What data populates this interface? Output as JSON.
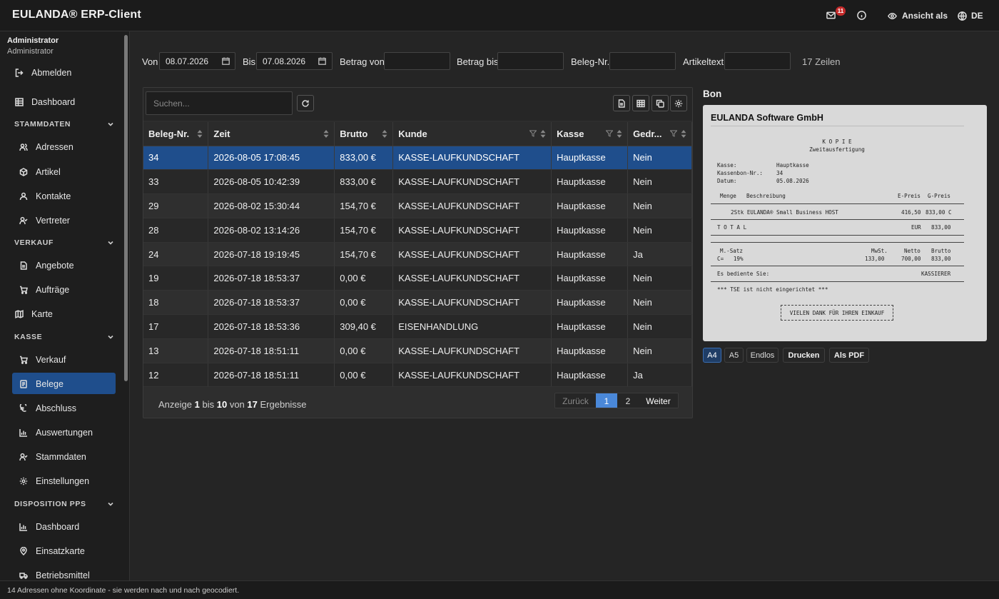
{
  "app": {
    "title": "EULANDA® ERP-Client"
  },
  "topbar": {
    "mail_badge": "11",
    "view_as": "Ansicht als",
    "lang": "DE"
  },
  "user": {
    "name": "Administrator",
    "role": "Administrator"
  },
  "sidebar": {
    "logout": "Abmelden",
    "dashboard": "Dashboard",
    "sections": {
      "stammdaten": {
        "title": "STAMMDATEN",
        "items": [
          "Adressen",
          "Artikel",
          "Kontakte",
          "Vertreter"
        ]
      },
      "verkauf": {
        "title": "VERKAUF",
        "items": [
          "Angebote",
          "Aufträge",
          "Karte"
        ]
      },
      "kasse": {
        "title": "KASSE",
        "items": [
          "Verkauf",
          "Belege",
          "Abschluss",
          "Auswertungen",
          "Stammdaten",
          "Einstellungen"
        ]
      },
      "dispo": {
        "title": "DISPOSITION PPS",
        "items": [
          "Dashboard",
          "Einsatzkarte",
          "Betriebsmittel"
        ]
      }
    }
  },
  "filters": {
    "von_label": "Von",
    "von_value": "08.07.2026",
    "bis_label": "Bis",
    "bis_value": "07.08.2026",
    "betrag_von_label": "Betrag von",
    "betrag_bis_label": "Betrag bis",
    "beleg_nr_label": "Beleg-Nr.",
    "artikeltext_label": "Artikeltext",
    "rows": "17 Zeilen"
  },
  "grid": {
    "search_placeholder": "Suchen...",
    "columns": [
      "Beleg-Nr.",
      "Zeit",
      "Brutto",
      "Kunde",
      "Kasse",
      "Gedr..."
    ],
    "rows": [
      [
        "34",
        "2026-08-05 17:08:45",
        "833,00 €",
        "KASSE-LAUFKUNDSCHAFT",
        "Hauptkasse",
        "Nein"
      ],
      [
        "33",
        "2026-08-05 10:42:39",
        "833,00 €",
        "KASSE-LAUFKUNDSCHAFT",
        "Hauptkasse",
        "Nein"
      ],
      [
        "29",
        "2026-08-02 15:30:44",
        "154,70 €",
        "KASSE-LAUFKUNDSCHAFT",
        "Hauptkasse",
        "Nein"
      ],
      [
        "28",
        "2026-08-02 13:14:26",
        "154,70 €",
        "KASSE-LAUFKUNDSCHAFT",
        "Hauptkasse",
        "Nein"
      ],
      [
        "24",
        "2026-07-18 19:19:45",
        "154,70 €",
        "KASSE-LAUFKUNDSCHAFT",
        "Hauptkasse",
        "Ja"
      ],
      [
        "19",
        "2026-07-18 18:53:37",
        "0,00 €",
        "KASSE-LAUFKUNDSCHAFT",
        "Hauptkasse",
        "Nein"
      ],
      [
        "18",
        "2026-07-18 18:53:37",
        "0,00 €",
        "KASSE-LAUFKUNDSCHAFT",
        "Hauptkasse",
        "Nein"
      ],
      [
        "17",
        "2026-07-18 18:53:36",
        "309,40 €",
        "EISENHANDLUNG",
        "Hauptkasse",
        "Nein"
      ],
      [
        "13",
        "2026-07-18 18:51:11",
        "0,00 €",
        "KASSE-LAUFKUNDSCHAFT",
        "Hauptkasse",
        "Nein"
      ],
      [
        "12",
        "2026-07-18 18:51:11",
        "0,00 €",
        "KASSE-LAUFKUNDSCHAFT",
        "Hauptkasse",
        "Ja"
      ]
    ],
    "footer": {
      "prefix": "Anzeige",
      "from": "1",
      "bis": "bis",
      "to": "10",
      "von": "von",
      "total": "17",
      "suffix": "Ergebnisse"
    },
    "pager": {
      "prev": "Zurück",
      "p1": "1",
      "p2": "2",
      "next": "Weiter"
    }
  },
  "bon": {
    "title": "Bon",
    "company": "EULANDA Software GmbH",
    "lines": {
      "kopie": "K O P I E",
      "zweit": "Zweitausfertigung",
      "kasse_l": "Kasse:",
      "kasse_v": "Hauptkasse",
      "bon_l": "Kassenbon-Nr.:",
      "bon_v": "34",
      "datum_l": "Datum:",
      "datum_v": "05.08.2026",
      "h_menge": "Menge",
      "h_beschr": "Beschreibung",
      "h_epreis": "E-Preis",
      "h_gpreis": "G-Preis",
      "item": "2Stk EULANDA® Small Business HOST",
      "item_e": "416,50",
      "item_g": "833,00 C",
      "total_l": "T O T A L",
      "total_cur": "EUR",
      "total_v": "833,00",
      "msatz": "M.-Satz",
      "mwst": "MwSt.",
      "netto": "Netto",
      "brutto": "Brutto",
      "c_rate": "C=   19%",
      "c_mwst": "133,00",
      "c_netto": "700,00",
      "c_brutto": "833,00",
      "bedient": "Es bediente Sie:",
      "kassierer": "KASSIERER",
      "tse": "*** TSE ist nicht eingerichtet ***",
      "thanks": "VIELEN DANK FÜR IHREN EINKAUF"
    },
    "formats": [
      "A4",
      "A5",
      "Endlos"
    ],
    "print": "Drucken",
    "pdf": "Als PDF"
  },
  "status": "14 Adressen ohne Koordinate - sie werden nach und nach geocodiert."
}
